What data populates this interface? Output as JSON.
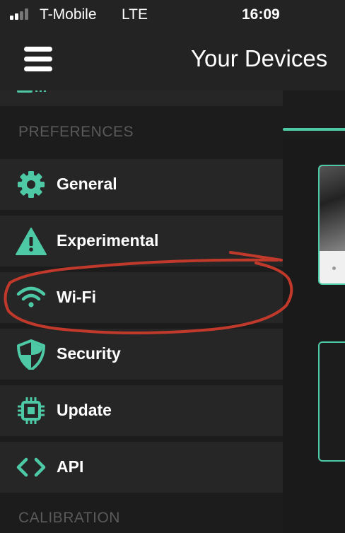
{
  "status_bar": {
    "carrier": "T-Mobile",
    "network": "LTE",
    "time": "16:09"
  },
  "header": {
    "title": "Your Devices",
    "menu_icon": "hamburger-menu-icon"
  },
  "drawer": {
    "sections": [
      {
        "title": "PREFERENCES",
        "items": [
          {
            "label": "General",
            "icon": "gear-icon"
          },
          {
            "label": "Experimental",
            "icon": "warning-triangle-icon"
          },
          {
            "label": "Wi-Fi",
            "icon": "wifi-icon"
          },
          {
            "label": "Security",
            "icon": "shield-icon"
          },
          {
            "label": "Update",
            "icon": "chip-icon"
          },
          {
            "label": "API",
            "icon": "code-brackets-icon"
          }
        ]
      },
      {
        "title": "CALIBRATION",
        "items": []
      }
    ]
  },
  "colors": {
    "accent": "#4ec9a6",
    "annotation": "#c0392b",
    "drawer_row": "#262626",
    "background": "#1c1c1c",
    "section_header": "#5a5a5a"
  }
}
